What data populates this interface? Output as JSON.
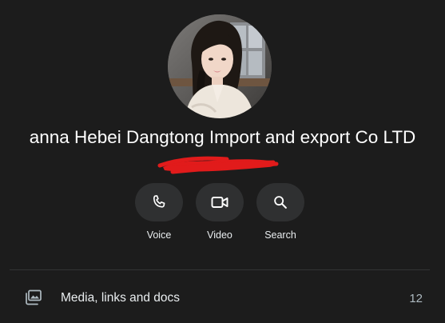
{
  "contact": {
    "name": "anna Hebei Dangtong Import and export Co LTD",
    "avatar_icon": "profile-photo",
    "redaction_color": "#e11b1b"
  },
  "actions": [
    {
      "label": "Voice",
      "icon": "phone-icon"
    },
    {
      "label": "Video",
      "icon": "video-camera-icon"
    },
    {
      "label": "Search",
      "icon": "search-icon"
    }
  ],
  "media": {
    "label": "Media, links and docs",
    "count": "12",
    "icon": "media-gallery-icon"
  },
  "theme": {
    "background": "#1c1c1c",
    "button_bg": "#2f3031",
    "text": "#e9edef",
    "muted_text": "#aebac1"
  }
}
